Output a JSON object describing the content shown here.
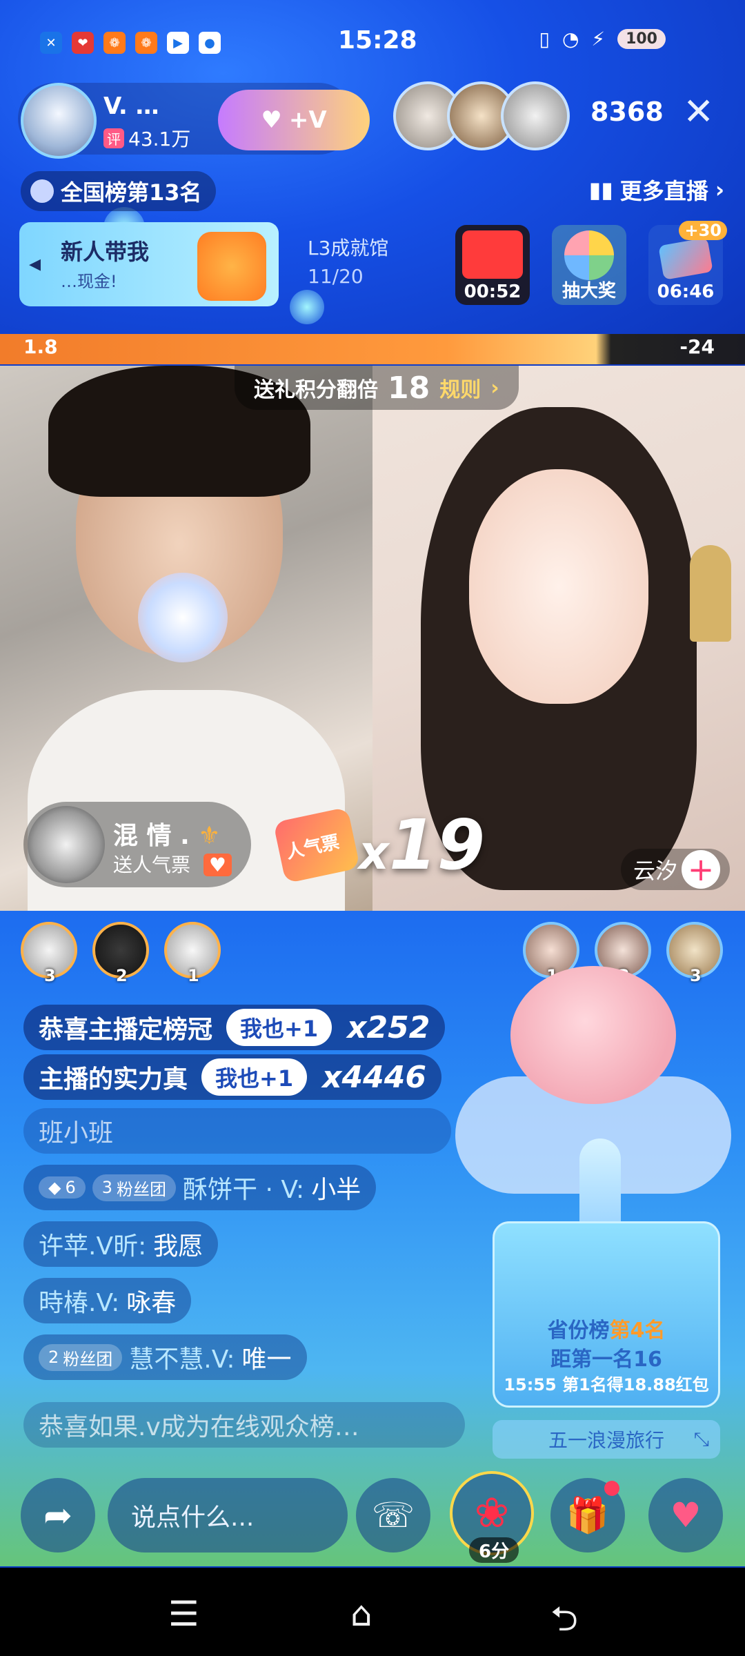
{
  "status_bar": {
    "time": "15:28",
    "battery": "100",
    "app_icons": [
      "x-app-icon",
      "red-envelope-icon",
      "orange-app-icon",
      "orange-app-icon-2",
      "video-app-icon",
      "chat-bubble-icon"
    ]
  },
  "host": {
    "name": "V. …",
    "fans_badge": "评",
    "fans_count": "43.1万",
    "follow_label": "+V"
  },
  "viewers": {
    "count": "8368"
  },
  "rank": {
    "label": "全国榜第13名"
  },
  "more_live": {
    "label": "更多直播"
  },
  "banner": {
    "title": "新人带我",
    "subtitle": "…现金!"
  },
  "level": {
    "title": "L3成就馆",
    "count": "11/20"
  },
  "activities": [
    {
      "label": "00:52",
      "color": "#ff3b3b"
    },
    {
      "label": "抽大奖",
      "color": "#7fd18a"
    },
    {
      "label": "06:46",
      "color": "#3a7af0",
      "badge": "+30"
    }
  ],
  "pk": {
    "left_value": "1.8",
    "right_value": "-24",
    "left_share_percent": 82
  },
  "multiplier": {
    "label": "送礼积分翻倍",
    "value": "18",
    "rules": "规则"
  },
  "gift_event": {
    "user_name": "混 情 .",
    "description": "送人气票",
    "combo_prefix": "x",
    "combo_count": "19",
    "gift_name": "人气票"
  },
  "guest": {
    "name": "云汐"
  },
  "left_ranks": [
    {
      "rank": "3"
    },
    {
      "rank": "2"
    },
    {
      "rank": "1"
    }
  ],
  "right_ranks": [
    {
      "rank": "1"
    },
    {
      "rank": "2"
    },
    {
      "rank": "3"
    }
  ],
  "chat": [
    {
      "text": "恭喜主播定榜冠",
      "button": "我也+1",
      "count": "x252"
    },
    {
      "text": "主播的实力真",
      "button": "我也+1",
      "count": "x4446"
    },
    {
      "text": "班小班"
    },
    {
      "badge1": "6",
      "badge2_level": "3",
      "badge2_label": "粉丝团",
      "name": "酥饼干 · V:",
      "text": "小半"
    },
    {
      "name": "许苹.V昕:",
      "text": "我愿"
    },
    {
      "name": "時椿.V:",
      "text": "咏春"
    },
    {
      "badge2_level": "2",
      "badge2_label": "粉丝团",
      "name": "慧不慧.V:",
      "text": "唯一"
    },
    {
      "text": "恭喜如果.v成为在线观众榜…"
    }
  ],
  "province_card": {
    "rank_prefix": "省份榜",
    "rank_value": "第4名",
    "gap": "距第一名16",
    "reward": "15:55 第1名得18.88红包"
  },
  "travel": {
    "label": "五一浪漫旅行"
  },
  "input": {
    "placeholder": "说点什么..."
  },
  "rose": {
    "price": "6分"
  }
}
